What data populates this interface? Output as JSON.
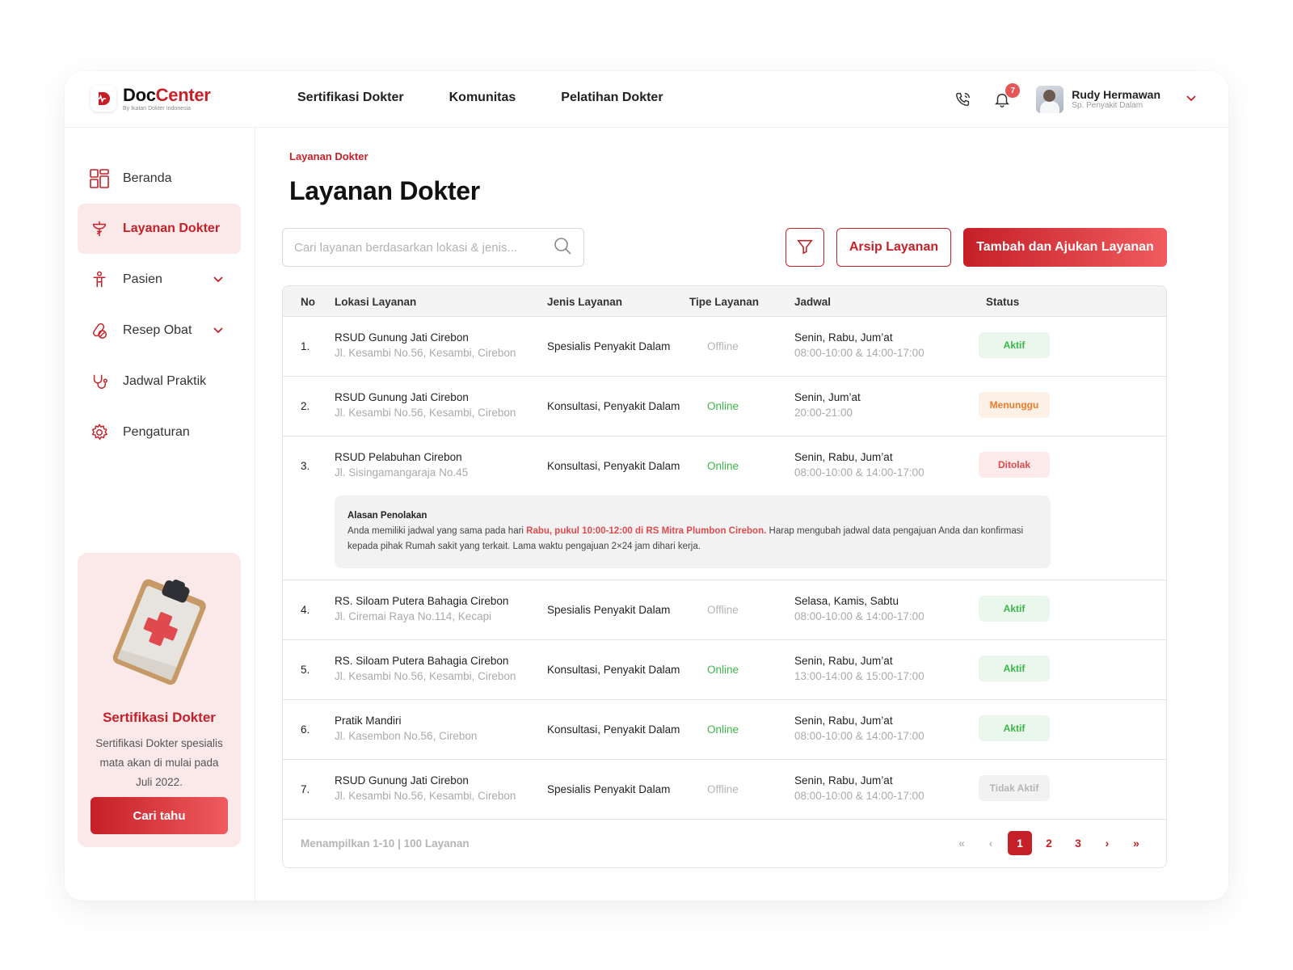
{
  "brand": {
    "name_a": "Doc",
    "name_b": "Center",
    "tagline": "By Ikatan Dokter Indonesia"
  },
  "topnav": [
    "Sertifikasi Dokter",
    "Komunitas",
    "Pelatihan Dokter"
  ],
  "notifications": {
    "count": "7"
  },
  "user": {
    "name": "Rudy Hermawan",
    "role": "Sp. Penyakit Dalam"
  },
  "sidebar": {
    "items": [
      {
        "label": "Beranda",
        "icon": "grid-icon"
      },
      {
        "label": "Layanan Dokter",
        "icon": "medical-service-icon"
      },
      {
        "label": "Pasien",
        "icon": "patient-icon"
      },
      {
        "label": "Resep Obat",
        "icon": "pill-icon"
      },
      {
        "label": "Jadwal Praktik",
        "icon": "stethoscope-icon"
      },
      {
        "label": "Pengaturan",
        "icon": "gear-icon"
      }
    ]
  },
  "promo": {
    "title": "Sertifikasi Dokter",
    "text": "Sertifikasi Dokter spesialis mata akan di mulai pada Juli 2022.",
    "button": "Cari tahu"
  },
  "page": {
    "breadcrumb": "Layanan Dokter",
    "title": "Layanan Dokter"
  },
  "search": {
    "placeholder": "Cari layanan berdasarkan lokasi & jenis..."
  },
  "actions": {
    "archive": "Arsip Layanan",
    "add": "Tambah dan Ajukan Layanan"
  },
  "table": {
    "headers": [
      "No",
      "Lokasi Layanan",
      "Jenis Layanan",
      "Tipe Layanan",
      "Jadwal",
      "Status"
    ],
    "rows": [
      {
        "no": "1.",
        "loc": "RSUD Gunung Jati Cirebon",
        "addr": "Jl. Kesambi No.56, Kesambi, Cirebon",
        "type": "Spesialis Penyakit Dalam",
        "mode": "Offline",
        "days": "Senin, Rabu, Jum’at",
        "hours": "08:00-10:00 & 14:00-17:00",
        "status": "Aktif"
      },
      {
        "no": "2.",
        "loc": "RSUD Gunung Jati Cirebon",
        "addr": "Jl. Kesambi No.56, Kesambi, Cirebon",
        "type": "Konsultasi, Penyakit Dalam",
        "mode": "Online",
        "days": "Senin, Jum’at",
        "hours": "20:00-21:00",
        "status": "Menunggu"
      },
      {
        "no": "3.",
        "loc": "RSUD Pelabuhan Cirebon",
        "addr": "Jl. Sisingamangaraja No.45",
        "type": "Konsultasi, Penyakit Dalam",
        "mode": "Online",
        "days": "Senin, Rabu, Jum’at",
        "hours": "08:00-10:00 & 14:00-17:00",
        "status": "Ditolak"
      },
      {
        "no": "4.",
        "loc": "RS. Siloam Putera Bahagia Cirebon",
        "addr": "Jl. Ciremai Raya No.114, Kecapi",
        "type": "Spesialis Penyakit Dalam",
        "mode": "Offline",
        "days": "Selasa, Kamis, Sabtu",
        "hours": "08:00-10:00 & 14:00-17:00",
        "status": "Aktif"
      },
      {
        "no": "5.",
        "loc": "RS. Siloam Putera Bahagia Cirebon",
        "addr": "Jl. Kesambi No.56, Kesambi, Cirebon",
        "type": "Konsultasi, Penyakit Dalam",
        "mode": "Online",
        "days": "Senin, Rabu, Jum’at",
        "hours": "13:00-14:00 & 15:00-17:00",
        "status": "Aktif"
      },
      {
        "no": "6.",
        "loc": "Pratik Mandiri",
        "addr": "Jl. Kasembon No.56, Cirebon",
        "type": "Konsultasi, Penyakit Dalam",
        "mode": "Online",
        "days": "Senin, Rabu, Jum’at",
        "hours": "08:00-10:00 & 14:00-17:00",
        "status": "Aktif"
      },
      {
        "no": "7.",
        "loc": "RSUD Gunung Jati Cirebon",
        "addr": "Jl. Kesambi No.56, Kesambi, Cirebon",
        "type": "Spesialis Penyakit Dalam",
        "mode": "Offline",
        "days": "Senin, Rabu, Jum’at",
        "hours": "08:00-10:00 & 14:00-17:00",
        "status": "Tidak Aktif"
      }
    ],
    "rejection": {
      "title": "Alasan Penolakan",
      "before": "Anda memiliki jadwal yang sama pada hari ",
      "highlight": "Rabu, pukul 10:00-12:00 di RS Mitra Plumbon Cirebon.",
      "after": " Harap mengubah jadwal data pengajuan Anda dan konfirmasi kepada pihak Rumah sakit yang terkait. Lama waktu pengajuan 2×24 jam dihari kerja."
    },
    "footer": "Menampilkan 1-10 | 100 Layanan"
  },
  "pagination": {
    "first": "«",
    "prev": "‹",
    "pages": [
      "1",
      "2",
      "3"
    ],
    "next": "›",
    "last": "»",
    "current": "1"
  },
  "colors": {
    "primary": "#c52028",
    "primary_light": "#ef5b5e",
    "success": "#3bb54a",
    "warning": "#ef7a2a",
    "danger": "#e04a4e"
  }
}
